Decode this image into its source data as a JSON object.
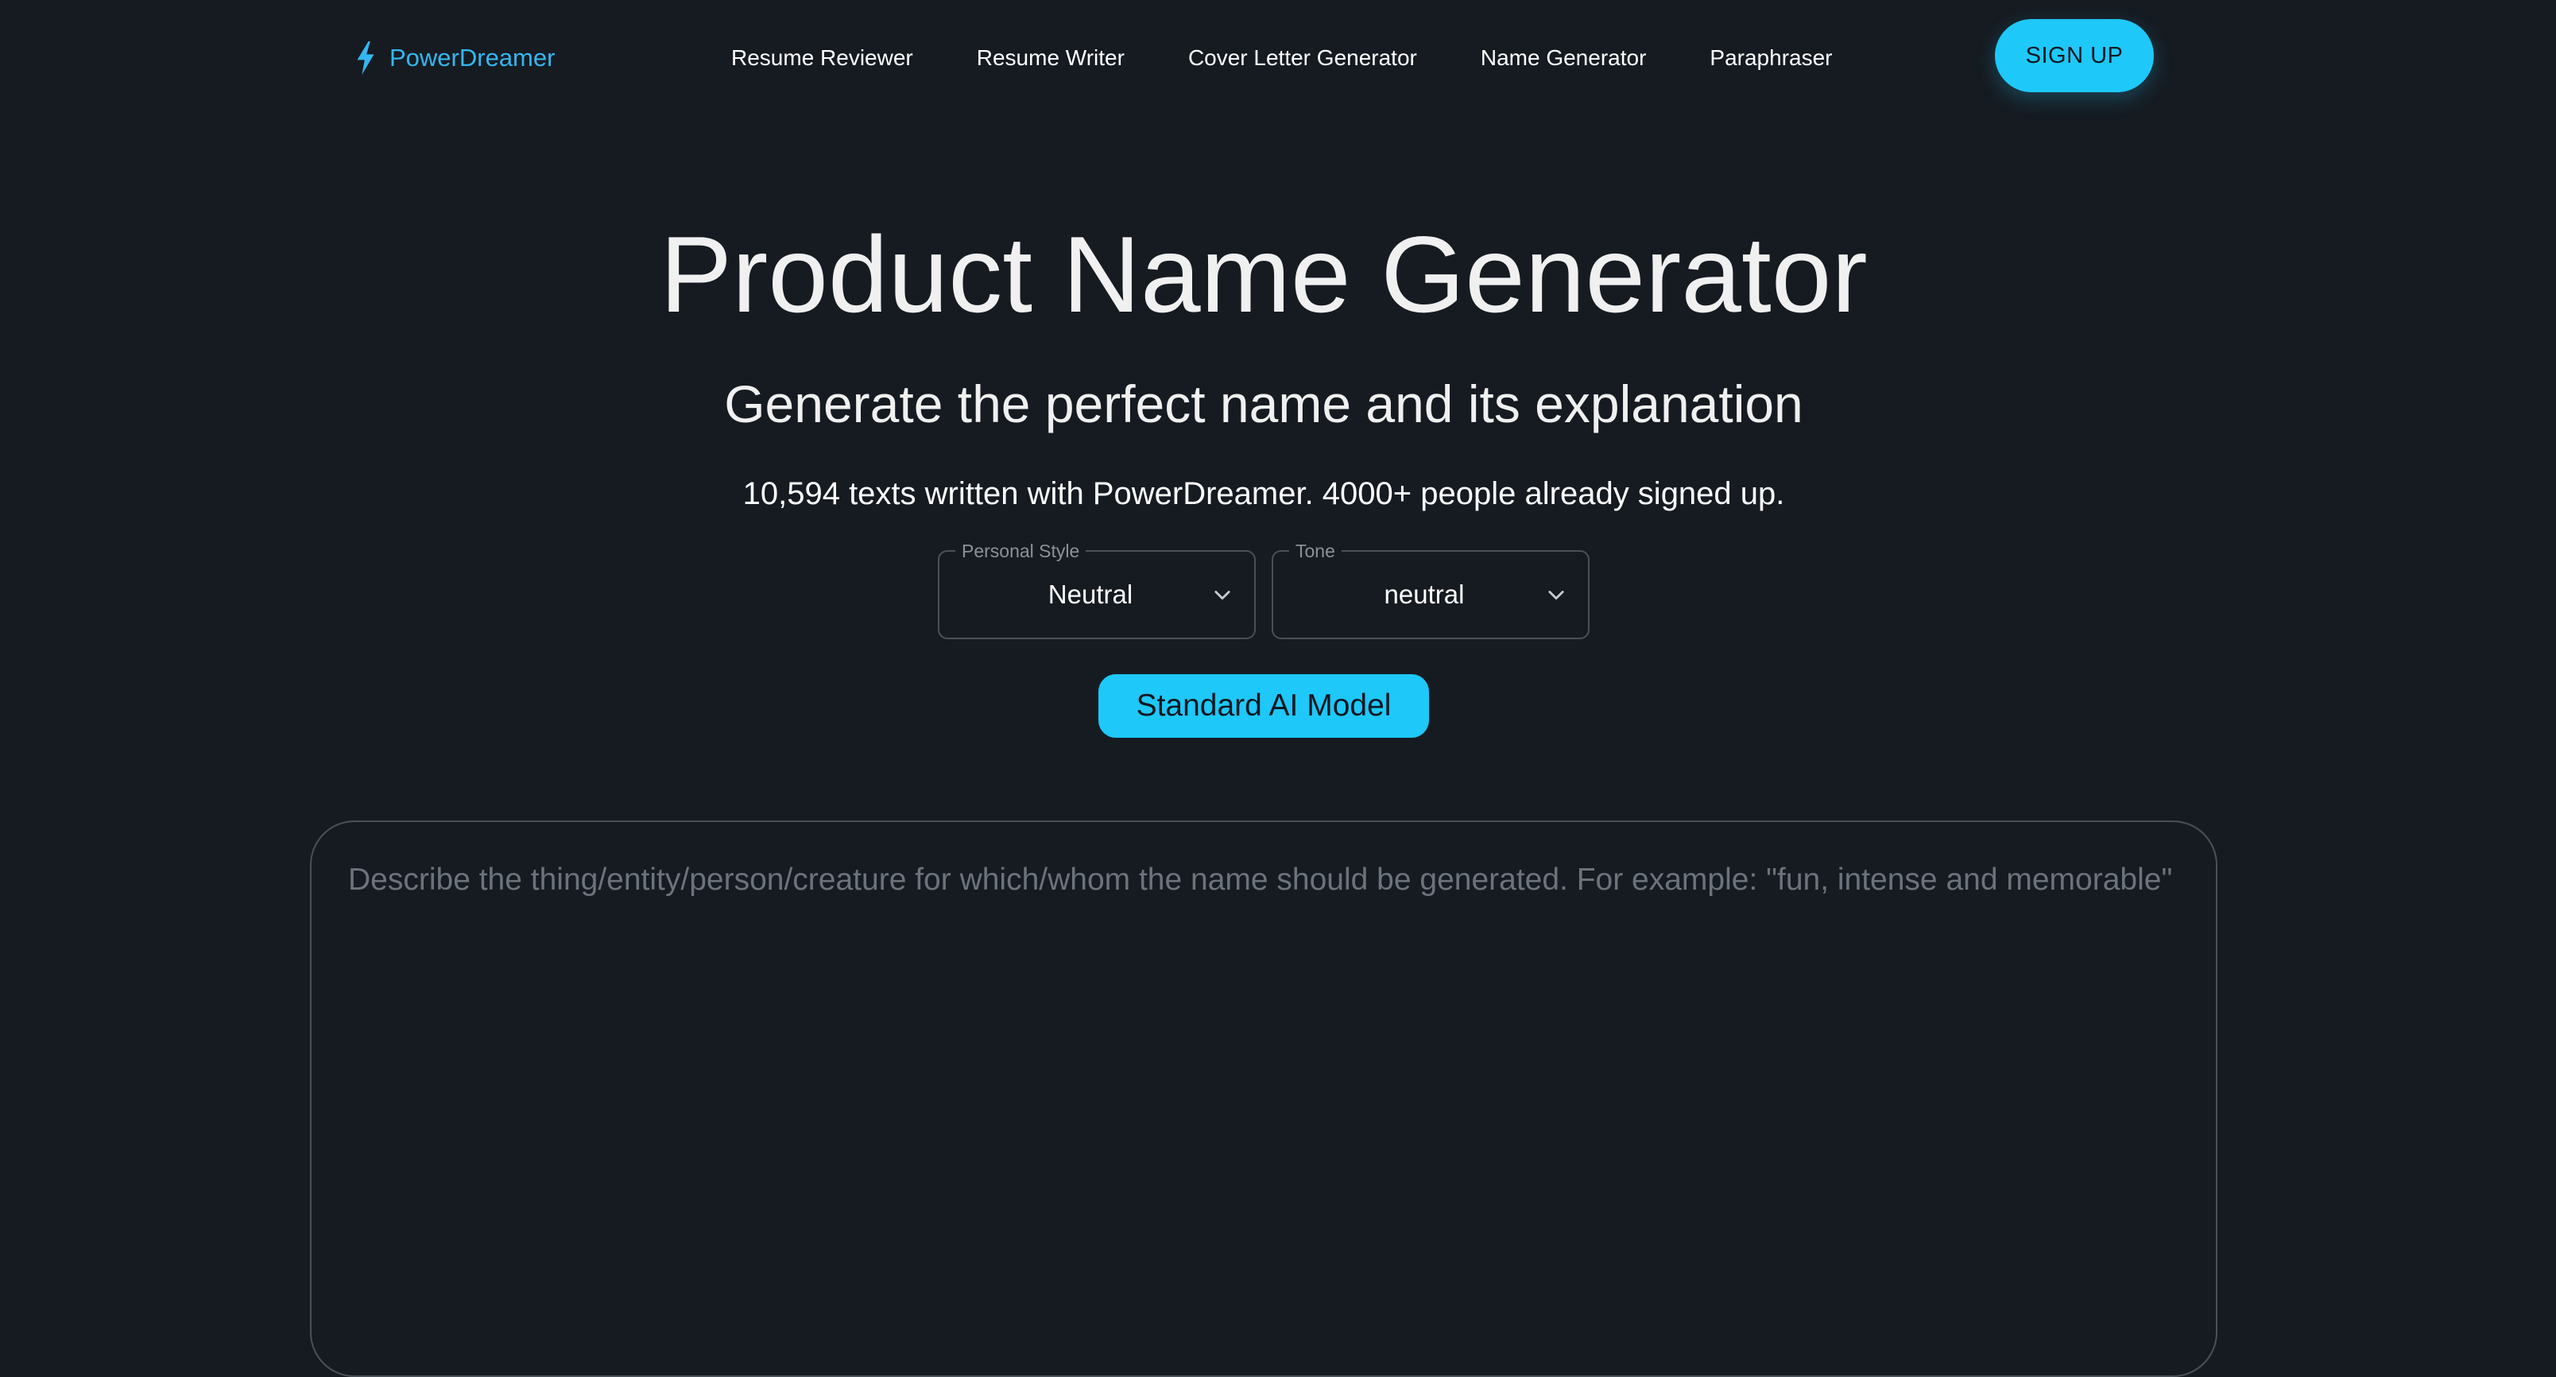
{
  "brand": {
    "name": "PowerDreamer",
    "icon": "lightning-bolt-icon",
    "color": "#34b7f1"
  },
  "nav": {
    "items": [
      {
        "label": "Resume Reviewer"
      },
      {
        "label": "Resume Writer"
      },
      {
        "label": "Cover Letter Generator"
      },
      {
        "label": "Name Generator"
      },
      {
        "label": "Paraphraser"
      }
    ]
  },
  "header": {
    "signup_label": "SIGN UP"
  },
  "hero": {
    "title": "Product Name Generator",
    "subtitle": "Generate the perfect name and its explanation",
    "stats": "10,594 texts written with PowerDreamer. 4000+ people already signed up."
  },
  "controls": {
    "personal_style": {
      "label": "Personal Style",
      "value": "Neutral"
    },
    "tone": {
      "label": "Tone",
      "value": "neutral"
    },
    "model_button_label": "Standard AI Model"
  },
  "description": {
    "placeholder": "Describe the thing/entity/person/creature for which/whom the name should be generated. For example: \"fun, intense and memorable\"",
    "value": ""
  },
  "colors": {
    "background": "#161b22",
    "accent": "#1ec8f9",
    "border": "#4a5058",
    "muted_text": "#6c737c"
  }
}
